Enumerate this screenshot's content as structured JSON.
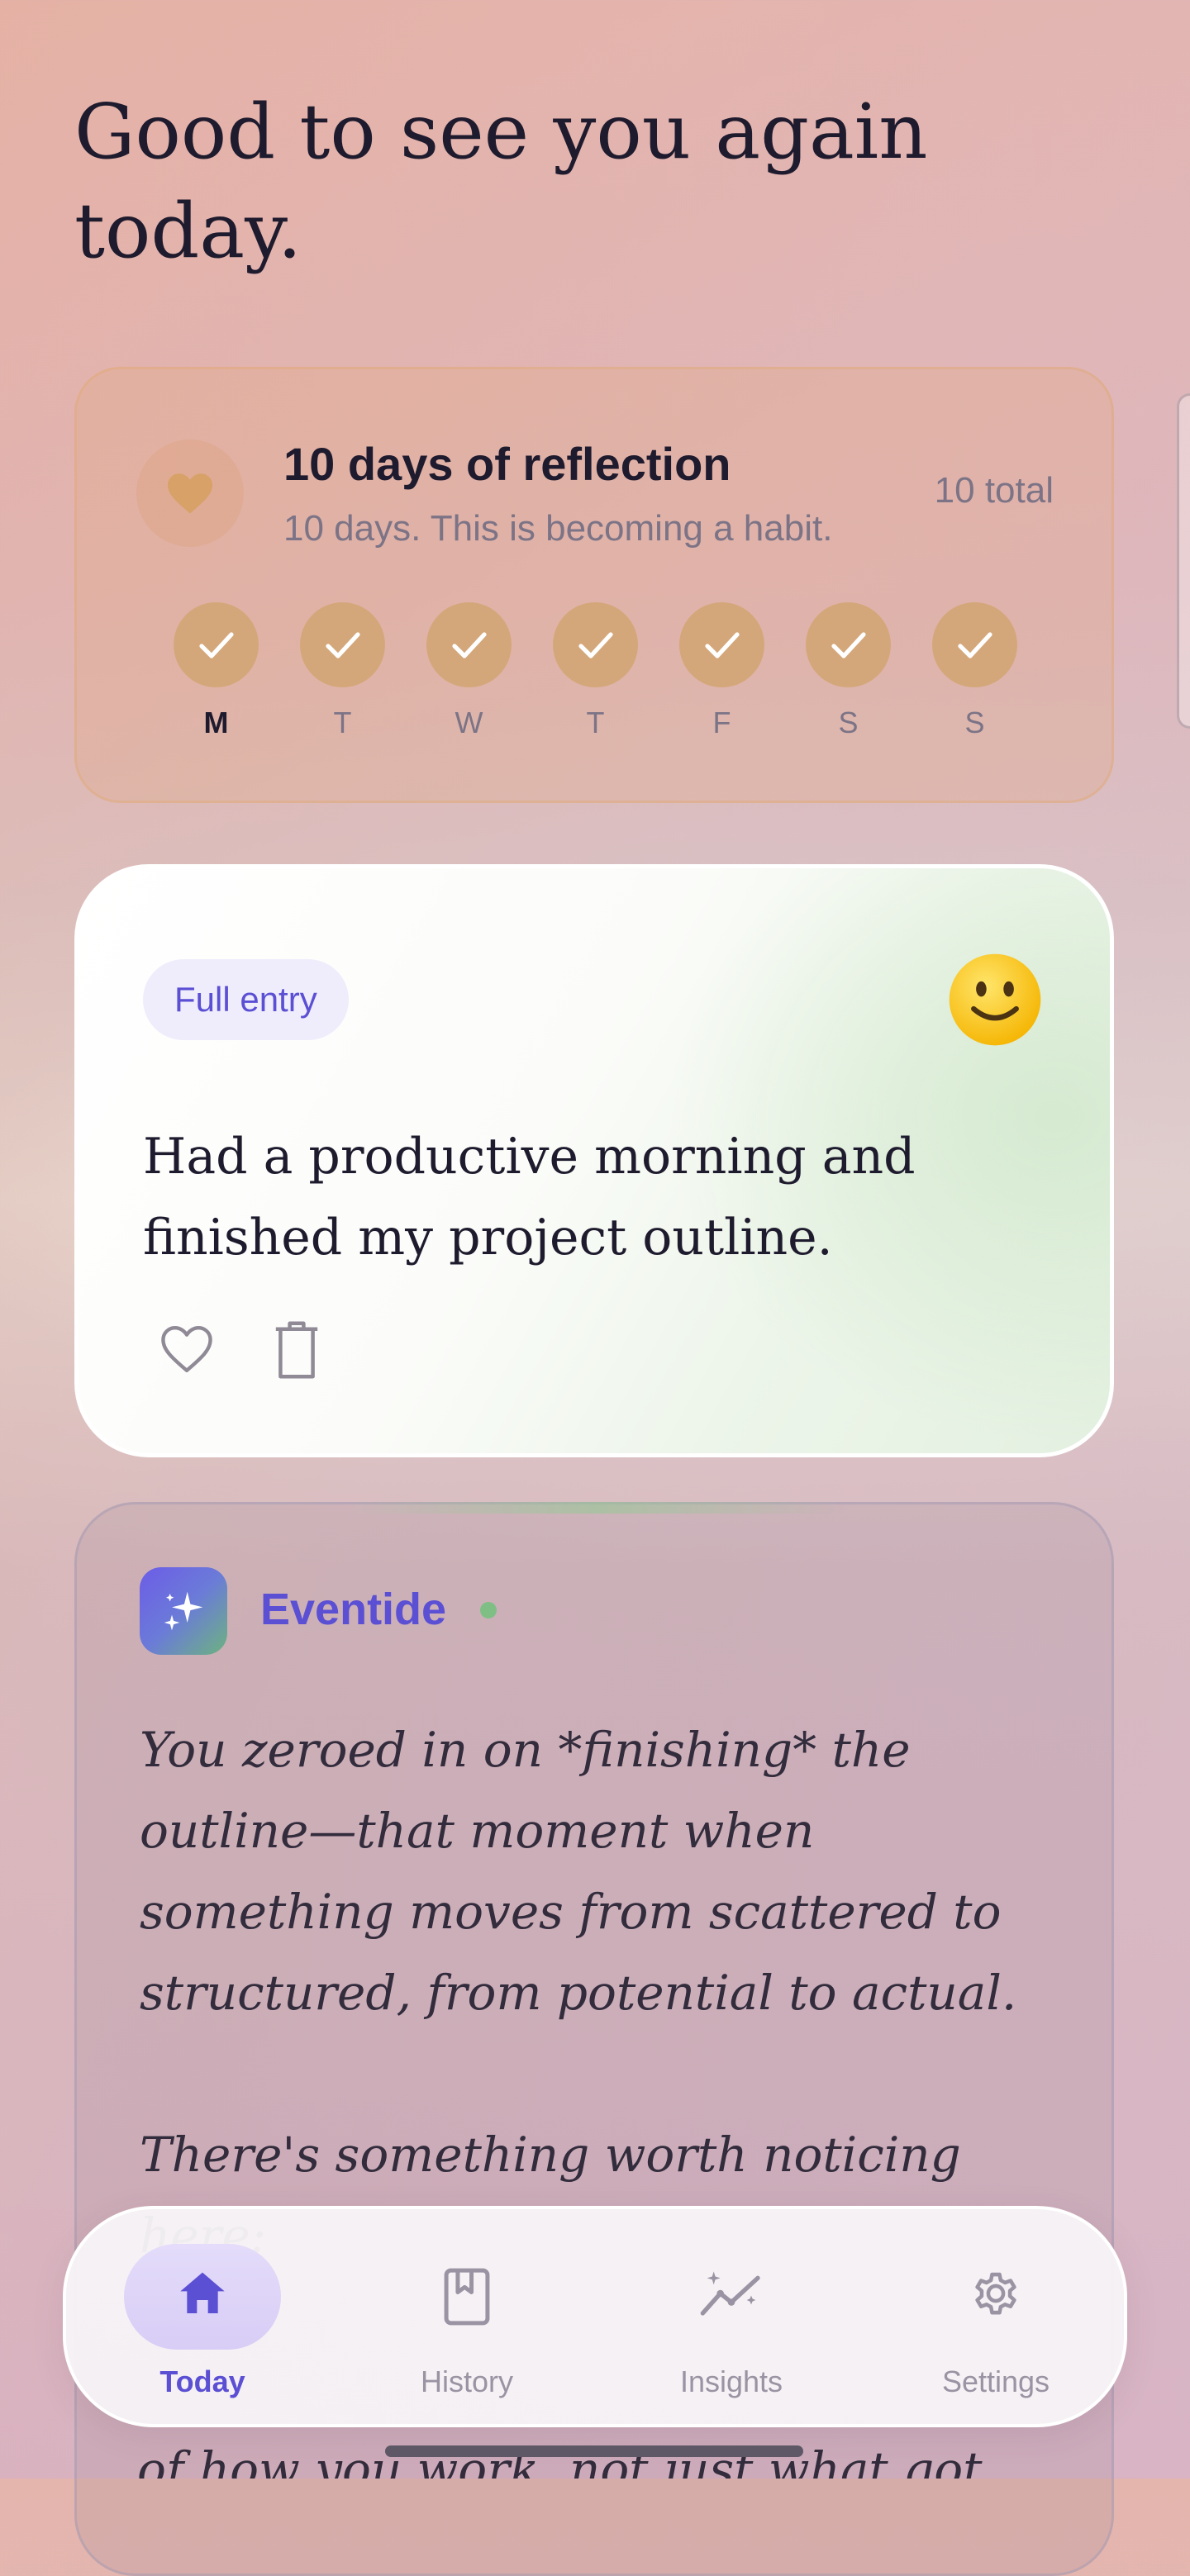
{
  "greeting": "Good to see you again today.",
  "streak": {
    "title": "10 days of reflection",
    "subtitle": "10 days. This is becoming a habit.",
    "total": "10 total",
    "days": [
      {
        "label": "M",
        "done": true,
        "current": true
      },
      {
        "label": "T",
        "done": true
      },
      {
        "label": "W",
        "done": true
      },
      {
        "label": "T",
        "done": true
      },
      {
        "label": "F",
        "done": true
      },
      {
        "label": "S",
        "done": true
      },
      {
        "label": "S",
        "done": true
      }
    ]
  },
  "entry": {
    "badge": "Full entry",
    "mood": "slightly-smiling-face",
    "text": "Had a productive morning and finished my project outline."
  },
  "reflection": {
    "author": "Eventide",
    "paragraph_1": "You zeroed in on *finishing* the outline—that moment when something moves from scattered to structured, from potential to actual.",
    "paragraph_2": "There's something worth noticing here:",
    "peek_line": "of how you work, not just what got"
  },
  "nav": {
    "items": [
      {
        "label": "Today",
        "icon": "home-icon",
        "active": true
      },
      {
        "label": "History",
        "icon": "book-icon",
        "active": false
      },
      {
        "label": "Insights",
        "icon": "trend-icon",
        "active": false
      },
      {
        "label": "Settings",
        "icon": "gear-icon",
        "active": false
      }
    ]
  },
  "colors": {
    "accent": "#5b4fd4",
    "streak_check": "#d4a77b",
    "status_dot": "#7fbf86"
  }
}
